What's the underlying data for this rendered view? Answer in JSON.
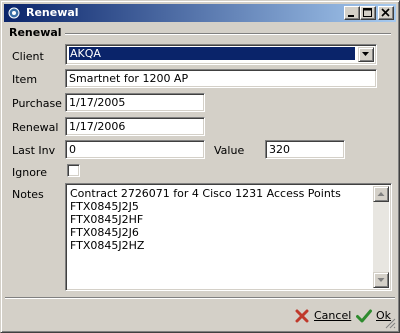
{
  "window": {
    "title": "Renewal"
  },
  "group": {
    "title": "Renewal"
  },
  "form": {
    "client": {
      "label": "Client",
      "value": "AKQA"
    },
    "item": {
      "label": "Item",
      "value": "Smartnet for 1200 AP"
    },
    "purchase": {
      "label": "Purchase",
      "value": "1/17/2005"
    },
    "renewal": {
      "label": "Renewal",
      "value": "1/17/2006"
    },
    "last_inv": {
      "label": "Last Inv",
      "value": "0"
    },
    "value": {
      "label": "Value",
      "value": "320"
    },
    "ignore": {
      "label": "Ignore",
      "checked": false
    },
    "notes": {
      "label": "Notes",
      "lines": [
        "Contract 2726071 for 4 Cisco 1231 Access Points",
        "FTX0845J2J5",
        "FTX0845J2HF",
        "FTX0845J2J6",
        "FTX0845J2HZ"
      ]
    }
  },
  "buttons": {
    "cancel": "Cancel",
    "ok": "Ok"
  },
  "colors": {
    "title_bar": "#0a246a",
    "selection": "#0a246a",
    "dialog_face": "#d4d0c8",
    "cancel_icon": "#c0392b",
    "ok_icon": "#2e8b2e"
  },
  "icons": {
    "title": "window-icon",
    "minimize": "minimize-icon",
    "maximize": "maximize-icon",
    "close": "close-icon",
    "combo": "chevron-down-icon",
    "cancel": "red-x-icon",
    "ok": "green-check-icon"
  }
}
